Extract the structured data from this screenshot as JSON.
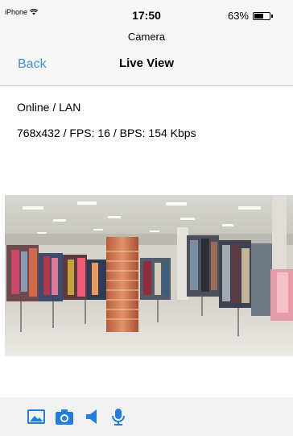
{
  "status_bar": {
    "carrier": "iPhone",
    "time": "17:50",
    "battery_percent": "63%",
    "battery_level": 0.63
  },
  "app": {
    "subtitle": "Camera"
  },
  "nav": {
    "back_label": "Back",
    "title": "Live View"
  },
  "stream_info": {
    "connection": "Online / LAN",
    "stats": "768x432 / FPS: 16 / BPS: 154 Kbps"
  },
  "toolbar": {
    "icons": [
      "image-icon",
      "camera-icon",
      "speaker-icon",
      "microphone-icon"
    ],
    "accent_color": "#1f7fe0"
  },
  "colors": {
    "link": "#3b8fe0",
    "bar_background": "#f7f7f7"
  }
}
